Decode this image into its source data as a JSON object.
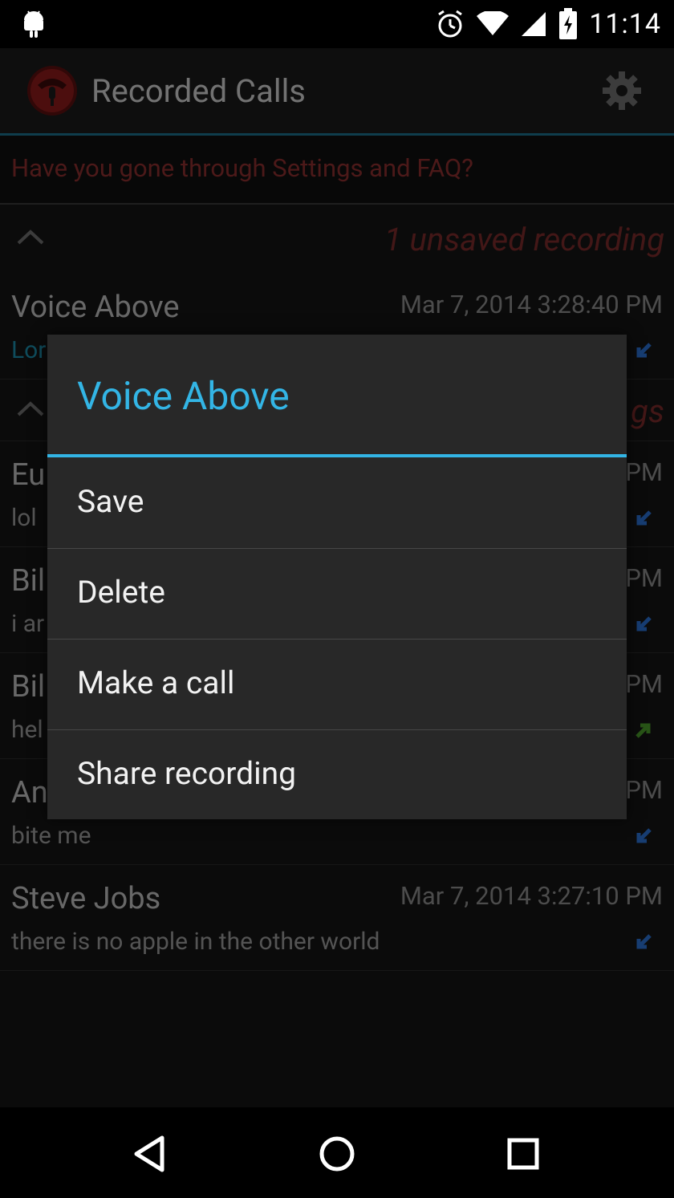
{
  "status_bar": {
    "time": "11:14"
  },
  "action_bar": {
    "title": "Recorded Calls"
  },
  "banner": {
    "text": "Have you gone through Settings and FAQ?"
  },
  "sections": {
    "unsaved": {
      "label": "1 unsaved recording"
    },
    "saved": {
      "label_fragment": "gs"
    }
  },
  "rows": [
    {
      "name": "Voice Above",
      "date": "Mar 7, 2014 3:28:40 PM",
      "note": "Lor",
      "direction": "incoming"
    },
    {
      "name": "Eu",
      "date": "PM",
      "note": "lol",
      "direction": "incoming"
    },
    {
      "name": "Bil",
      "date": "PM",
      "note": "i ar",
      "direction": "incoming"
    },
    {
      "name": "Bil",
      "date": "PM",
      "note": "hel",
      "direction": "outgoing"
    },
    {
      "name": "An",
      "date": "PM",
      "note": "bite me",
      "direction": "incoming"
    },
    {
      "name": "Steve Jobs",
      "date": "Mar 7, 2014 3:27:10 PM",
      "note": "there is no apple in the other world",
      "direction": "incoming"
    }
  ],
  "dialog": {
    "title": "Voice Above",
    "items": [
      "Save",
      "Delete",
      "Make a call",
      "Share recording"
    ]
  },
  "colors": {
    "accent": "#33b5e5",
    "dialog_bg": "#282828",
    "unsaved_red": "#7a2a2a",
    "incoming_arrow": "#2a6fd0",
    "outgoing_arrow": "#4a9a2a"
  },
  "icons": [
    "android-icon",
    "alarm-icon",
    "wifi-icon",
    "signal-icon",
    "battery-charging-icon",
    "app-logo-icon",
    "gear-icon",
    "chevron-up-icon",
    "incoming-call-icon",
    "outgoing-call-icon",
    "back-icon",
    "home-icon",
    "recents-icon"
  ]
}
